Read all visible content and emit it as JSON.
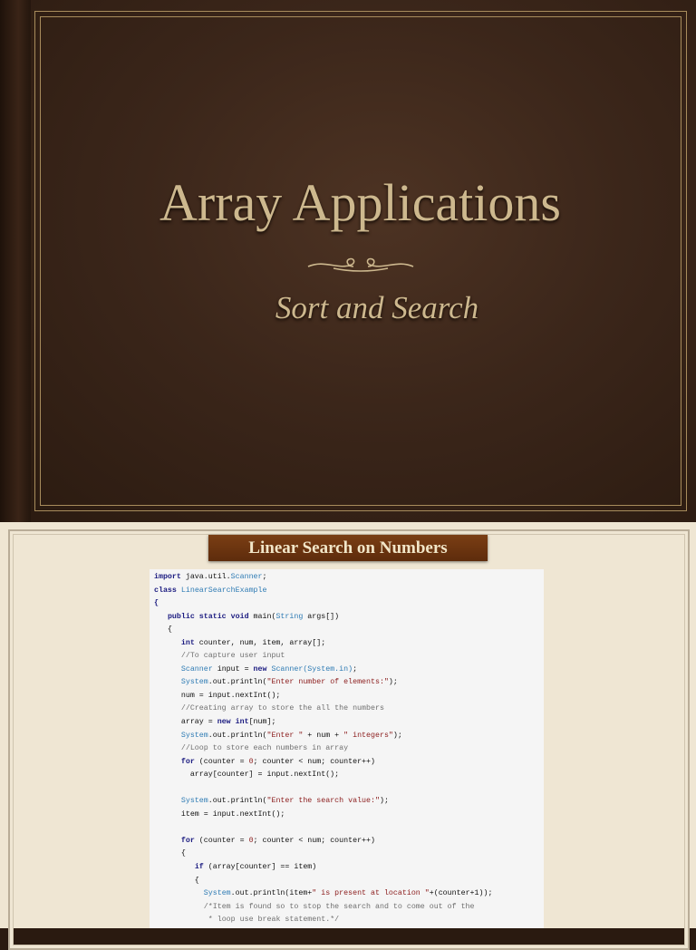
{
  "title_slide": {
    "title": "Array Applications",
    "subtitle": "Sort and Search",
    "colors": {
      "leather": "#3b261a",
      "gold": "#cdb88e"
    }
  },
  "code_slide": {
    "heading": "Linear Search on Numbers",
    "colors": {
      "banner": "#6b3410",
      "keyword": "#1b1b80",
      "type": "#2e7bb4",
      "string": "#8b1c1c",
      "comment": "#6f6f6f"
    },
    "code_lines": [
      [
        [
          "import",
          "k"
        ],
        [
          " java.util.",
          "p"
        ],
        [
          "Scanner",
          "t"
        ],
        [
          ";",
          "p"
        ]
      ],
      [
        [
          "class",
          "k"
        ],
        [
          " LinearSearchExample",
          "t"
        ]
      ],
      [
        [
          "{",
          "k"
        ]
      ],
      [
        [
          "   ",
          "p"
        ],
        [
          "public static void",
          "k"
        ],
        [
          " main(",
          "p"
        ],
        [
          "String",
          "t"
        ],
        [
          " args[])",
          "p"
        ]
      ],
      [
        [
          "   {",
          "p"
        ]
      ],
      [
        [
          "      ",
          "p"
        ],
        [
          "int",
          "k"
        ],
        [
          " counter, num, item, array[];",
          "p"
        ]
      ],
      [
        [
          "      ",
          "p"
        ],
        [
          "//To capture user input",
          "c"
        ]
      ],
      [
        [
          "      ",
          "p"
        ],
        [
          "Scanner",
          "t"
        ],
        [
          " input = ",
          "p"
        ],
        [
          "new",
          "k"
        ],
        [
          " Scanner(System.in)",
          "t"
        ],
        [
          ";",
          "p"
        ]
      ],
      [
        [
          "      ",
          "p"
        ],
        [
          "System",
          "t"
        ],
        [
          ".out.println(",
          "p"
        ],
        [
          "\"Enter number of elements:\"",
          "s"
        ],
        [
          ");",
          "p"
        ]
      ],
      [
        [
          "      num = input.nextInt();",
          "p"
        ]
      ],
      [
        [
          "      ",
          "p"
        ],
        [
          "//Creating array to store the all the numbers",
          "c"
        ]
      ],
      [
        [
          "      array = ",
          "p"
        ],
        [
          "new int",
          "k"
        ],
        [
          "[num];",
          "p"
        ]
      ],
      [
        [
          "      ",
          "p"
        ],
        [
          "System",
          "t"
        ],
        [
          ".out.println(",
          "p"
        ],
        [
          "\"Enter \"",
          "s"
        ],
        [
          " + num + ",
          "p"
        ],
        [
          "\" integers\"",
          "s"
        ],
        [
          ");",
          "p"
        ]
      ],
      [
        [
          "      ",
          "p"
        ],
        [
          "//Loop to store each numbers in array",
          "c"
        ]
      ],
      [
        [
          "      ",
          "p"
        ],
        [
          "for",
          "k"
        ],
        [
          " (counter = ",
          "p"
        ],
        [
          "0",
          "s"
        ],
        [
          "; counter < num; counter++)",
          "p"
        ]
      ],
      [
        [
          "        array[counter] = input.nextInt();",
          "p"
        ]
      ],
      [
        [
          "",
          "p"
        ]
      ],
      [
        [
          "      ",
          "p"
        ],
        [
          "System",
          "t"
        ],
        [
          ".out.println(",
          "p"
        ],
        [
          "\"Enter the search value:\"",
          "s"
        ],
        [
          ");",
          "p"
        ]
      ],
      [
        [
          "      item = input.nextInt();",
          "p"
        ]
      ],
      [
        [
          "",
          "p"
        ]
      ],
      [
        [
          "      ",
          "p"
        ],
        [
          "for",
          "k"
        ],
        [
          " (counter = ",
          "p"
        ],
        [
          "0",
          "s"
        ],
        [
          "; counter < num; counter++)",
          "p"
        ]
      ],
      [
        [
          "      {",
          "p"
        ]
      ],
      [
        [
          "         ",
          "p"
        ],
        [
          "if",
          "k"
        ],
        [
          " (array[counter] == item)",
          "p"
        ]
      ],
      [
        [
          "         {",
          "p"
        ]
      ],
      [
        [
          "           ",
          "p"
        ],
        [
          "System",
          "t"
        ],
        [
          ".out.println(item+",
          "p"
        ],
        [
          "\" is present at location \"",
          "s"
        ],
        [
          "+(counter+1));",
          "p"
        ]
      ],
      [
        [
          "           ",
          "p"
        ],
        [
          "/*Item is found so to stop the search and to come out of the",
          "c"
        ]
      ],
      [
        [
          "           ",
          "p"
        ],
        [
          " * loop use break statement.*/",
          "c"
        ]
      ]
    ]
  }
}
